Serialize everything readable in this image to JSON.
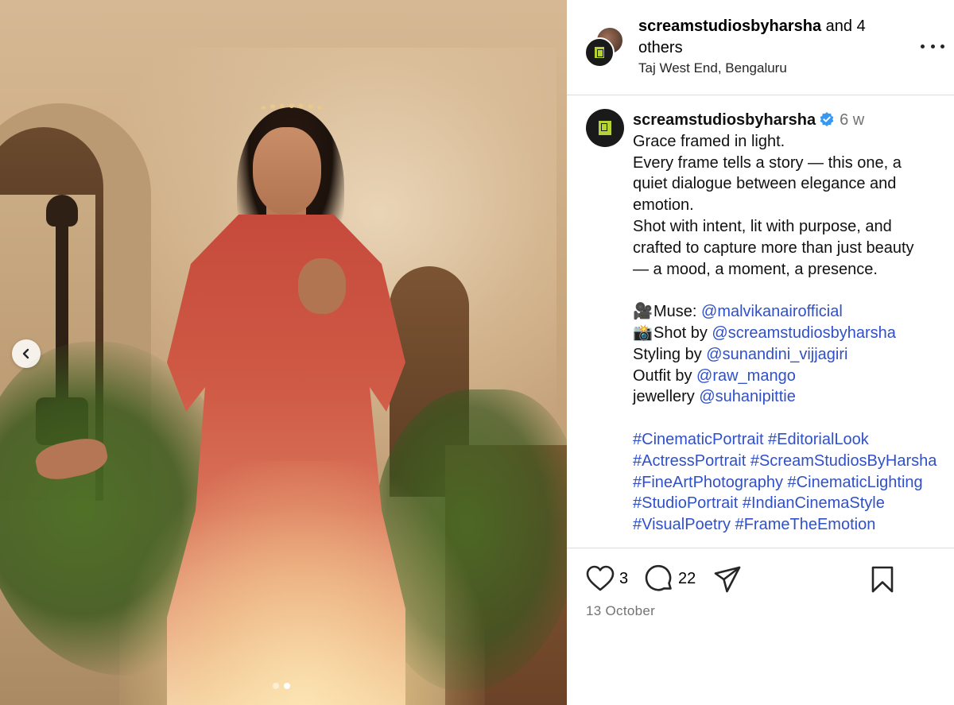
{
  "post": {
    "header": {
      "author": "screamstudiosbyharsha",
      "and_others": "and 4 others",
      "location": "Taj West End, Bengaluru"
    },
    "caption": {
      "author": "screamstudiosbyharsha",
      "age": "6 w",
      "lines": [
        "Grace framed in light.",
        "Every frame tells a story — this one, a",
        "quiet dialogue between elegance and",
        "emotion.",
        "Shot with intent, lit with purpose, and",
        "crafted to capture more than just beauty",
        "— a mood, a moment, a presence."
      ],
      "credits": [
        {
          "emoji": "🎥",
          "label": "Muse: ",
          "handle": "@malvikanairofficial"
        },
        {
          "emoji": "📸",
          "label": "Shot by ",
          "handle": "@screamstudiosbyharsha"
        },
        {
          "emoji": "",
          "label": "Styling by ",
          "handle": "@sunandini_vijjagiri"
        },
        {
          "emoji": "",
          "label": "Outfit by ",
          "handle": "@raw_mango"
        },
        {
          "emoji": "",
          "label": "jewellery ",
          "handle": "@suhanipittie"
        }
      ],
      "hashtag_lines": [
        "#CinematicPortrait #EditorialLook",
        "#ActressPortrait #ScreamStudiosByHarsha",
        "#FineArtPhotography #CinematicLighting",
        "#StudioPortrait #IndianCinemaStyle",
        "#VisualPoetry #FrameTheEmotion"
      ]
    },
    "actions": {
      "like_count": "3",
      "comment_count": "22"
    },
    "date": "13 October",
    "carousel": {
      "count": 2,
      "active_index": 1
    }
  },
  "icons": {
    "more": "more-horizontal-icon",
    "prev": "chevron-left-icon",
    "like": "heart-icon",
    "comment": "comment-icon",
    "share": "share-icon",
    "save": "bookmark-icon",
    "verified": "verified-badge-icon"
  },
  "colors": {
    "link": "#3050c8",
    "verified": "#3897f0",
    "muted": "#737373",
    "logo_accent": "#b6d334"
  }
}
